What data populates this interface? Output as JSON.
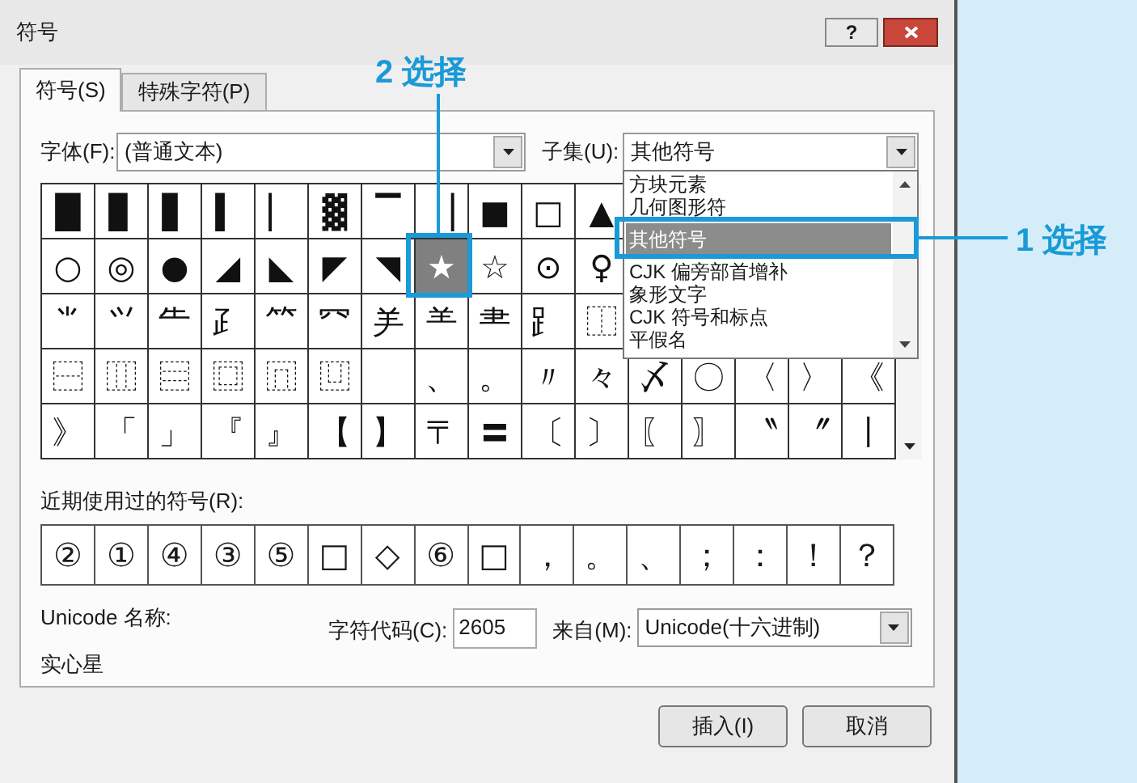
{
  "window": {
    "title": "符号",
    "help_button": "?"
  },
  "tabs": [
    {
      "label": "符号(S)",
      "selected": true
    },
    {
      "label": "特殊字符(P)",
      "selected": false
    }
  ],
  "font": {
    "label": "字体(F):",
    "value": "(普通文本)"
  },
  "subset": {
    "label": "子集(U):",
    "value": "其他符号",
    "expanded": true,
    "options": [
      {
        "label": "方块元素",
        "selected": false
      },
      {
        "label": "几何图形符",
        "selected": false
      },
      {
        "label": "其他符号",
        "selected": true
      },
      {
        "label": "CJK 偏旁部首增补",
        "selected": false
      },
      {
        "label": "象形文字",
        "selected": false
      },
      {
        "label": "CJK 符号和标点",
        "selected": false
      },
      {
        "label": "平假名",
        "selected": false
      }
    ]
  },
  "symbol_grid": [
    [
      {
        "char": "█",
        "selected": false
      },
      {
        "char": "▊",
        "selected": false
      },
      {
        "char": "▋",
        "selected": false
      },
      {
        "char": "▍",
        "selected": false
      },
      {
        "char": "▏",
        "selected": false
      },
      {
        "char": "▓",
        "selected": false
      },
      {
        "char": "▔",
        "selected": false
      },
      {
        "char": "▕",
        "selected": false
      },
      {
        "char": "■",
        "selected": false
      },
      {
        "char": "□",
        "selected": false
      },
      {
        "char": "▲",
        "selected": false
      }
    ],
    [
      {
        "char": "○",
        "selected": false
      },
      {
        "char": "◎",
        "selected": false
      },
      {
        "char": "●",
        "selected": false
      },
      {
        "char": "◢",
        "selected": false
      },
      {
        "char": "◣",
        "selected": false
      },
      {
        "char": "◤",
        "selected": false
      },
      {
        "char": "◥",
        "selected": false
      },
      {
        "char": "★",
        "selected": true
      },
      {
        "char": "☆",
        "selected": false
      },
      {
        "char": "⊙",
        "selected": false
      },
      {
        "char": "♀",
        "selected": false
      }
    ],
    [
      {
        "char": "⺌",
        "selected": false
      },
      {
        "char": "⺍",
        "selected": false
      },
      {
        "char": "⺧",
        "selected": false
      },
      {
        "char": "⺪",
        "selected": false
      },
      {
        "char": "⺮",
        "selected": false
      },
      {
        "char": "⺳",
        "selected": false
      },
      {
        "char": "⺶",
        "selected": false
      },
      {
        "char": "⺷",
        "selected": false
      },
      {
        "char": "⺻",
        "selected": false
      },
      {
        "char": "⻊",
        "selected": false
      },
      {
        "char": "⿰",
        "selected": false
      }
    ],
    [
      {
        "char": "⿱",
        "selected": false
      },
      {
        "char": "⿲",
        "selected": false
      },
      {
        "char": "⿳",
        "selected": false
      },
      {
        "char": "⿴",
        "selected": false
      },
      {
        "char": "⿵",
        "selected": false
      },
      {
        "char": "⿶",
        "selected": false
      },
      {
        "selected": false
      },
      {
        "char": "、",
        "selected": false
      },
      {
        "char": "。",
        "selected": false
      },
      {
        "char": "〃",
        "selected": false
      },
      {
        "char": "々",
        "selected": false
      },
      {
        "char": "〆",
        "selected": false
      },
      {
        "char": "〇",
        "selected": false
      },
      {
        "char": "〈",
        "selected": false
      },
      {
        "char": "〉",
        "selected": false
      },
      {
        "char": "《",
        "selected": false
      }
    ],
    [
      {
        "char": "》",
        "selected": false
      },
      {
        "char": "「",
        "selected": false
      },
      {
        "char": "」",
        "selected": false
      },
      {
        "char": "『",
        "selected": false
      },
      {
        "char": "』",
        "selected": false
      },
      {
        "char": "【",
        "selected": false
      },
      {
        "char": "】",
        "selected": false
      },
      {
        "char": "〒",
        "selected": false
      },
      {
        "char": "〓",
        "selected": false
      },
      {
        "char": "〔",
        "selected": false
      },
      {
        "char": "〕",
        "selected": false
      },
      {
        "char": "〖",
        "selected": false
      },
      {
        "char": "〗",
        "selected": false
      },
      {
        "char": "〝",
        "selected": false
      },
      {
        "char": "〞",
        "selected": false
      },
      {
        "char": "〡",
        "selected": false
      }
    ]
  ],
  "recent": {
    "label": "近期使用过的符号(R):",
    "symbols": [
      "②",
      "①",
      "④",
      "③",
      "⑤",
      "□",
      "◇",
      "⑥",
      "□",
      "，",
      "。",
      "、",
      "；",
      "：",
      "！",
      "？"
    ]
  },
  "unicode_name": {
    "label": "Unicode 名称:",
    "value": "实心星"
  },
  "char_code": {
    "label": "字符代码(C):",
    "value": "2605"
  },
  "from": {
    "label": "来自(M):",
    "value": "Unicode(十六进制)"
  },
  "buttons": [
    "插入(I)",
    "取消"
  ],
  "annotations": [
    {
      "label": "1 选择"
    },
    {
      "label": "2 选择"
    }
  ]
}
